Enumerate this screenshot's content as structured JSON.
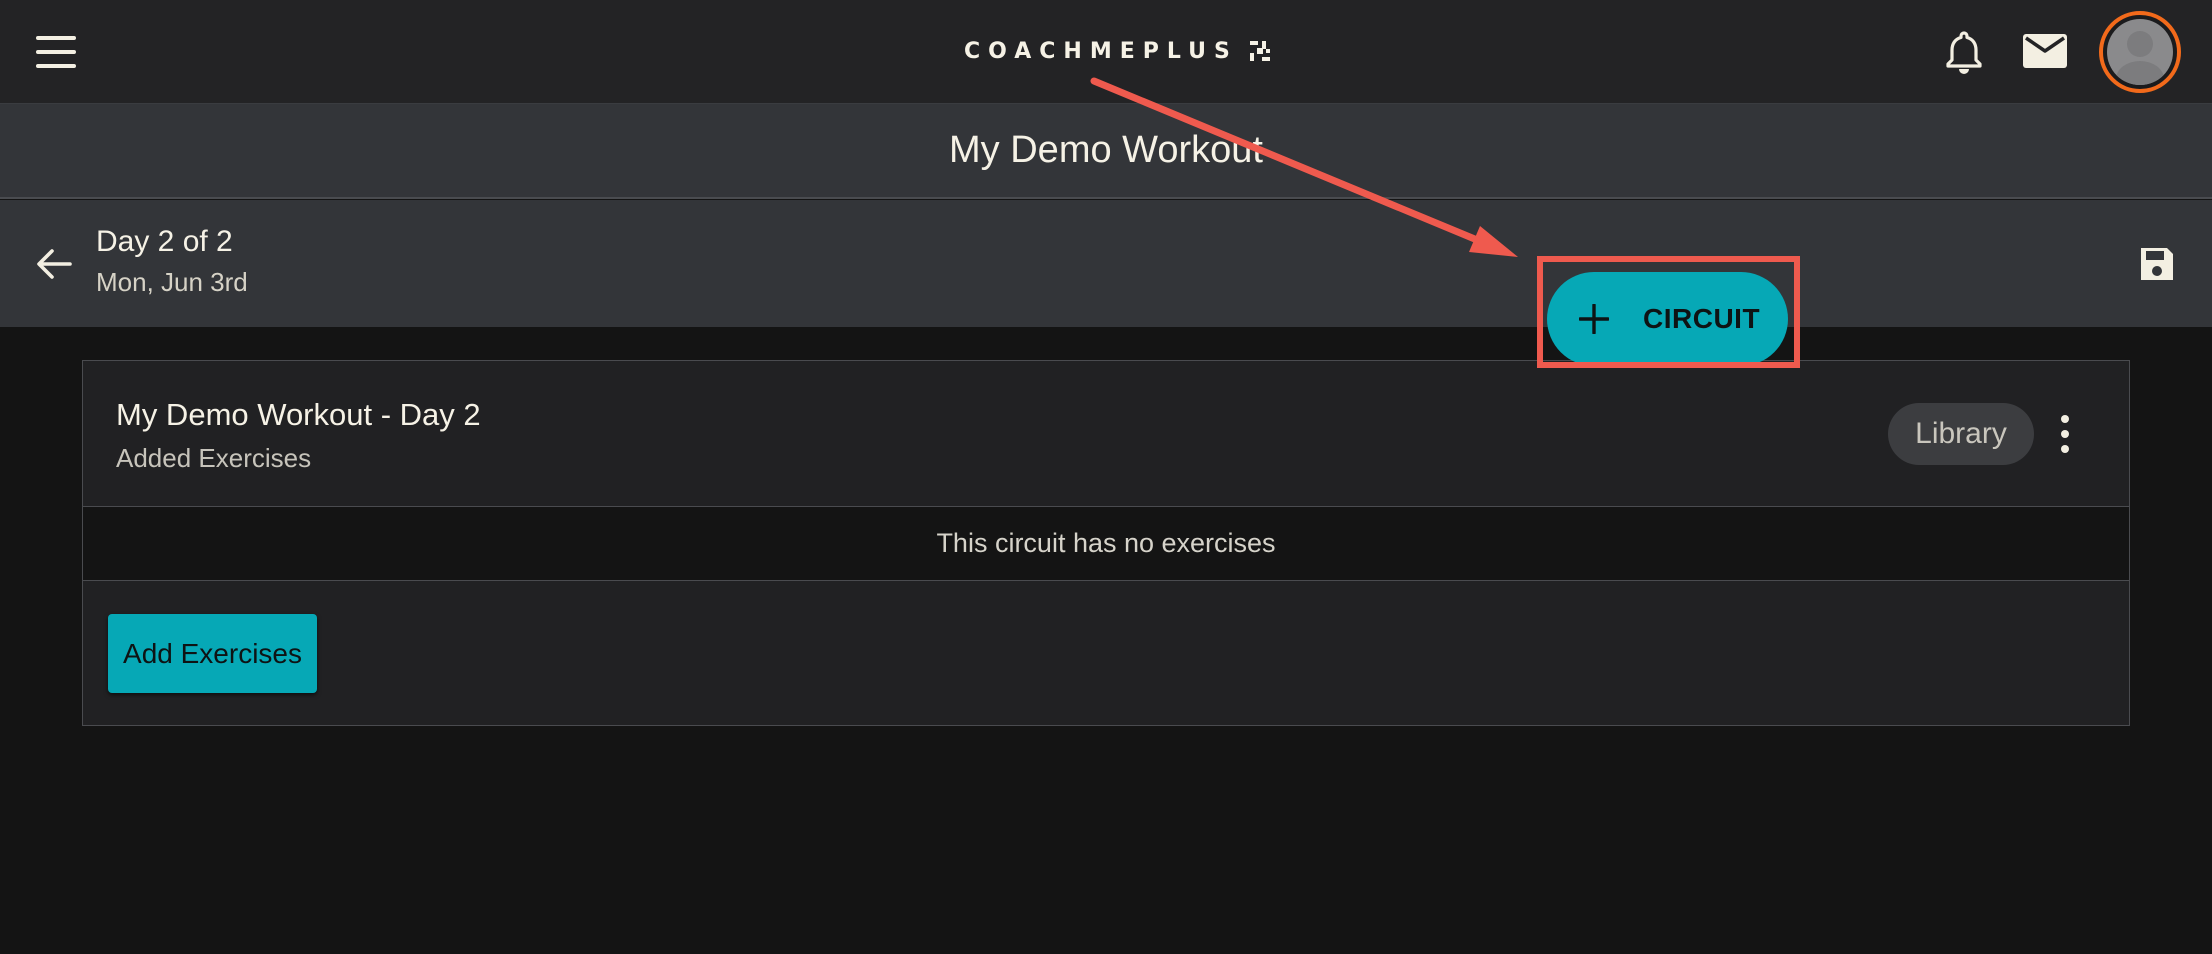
{
  "header": {
    "logo_text": "COACHMEPLUS",
    "icons": [
      "menu-icon",
      "bell-icon",
      "mail-icon",
      "avatar"
    ],
    "avatar_ring_color": "#f26a1b"
  },
  "workout": {
    "title": "My Demo Workout"
  },
  "day_nav": {
    "day_label": "Day 2 of 2",
    "date_label": "Mon, Jun 3rd"
  },
  "circuit_card": {
    "title": "My Demo Workout - Day 2",
    "subtitle": "Added Exercises",
    "library_label": "Library",
    "empty_message": "This circuit has no exercises",
    "add_exercises_label": "Add Exercises"
  },
  "fab": {
    "label": "CIRCUIT"
  },
  "colors": {
    "accent": "#06a8b6",
    "annotation": "#ef5a4e",
    "background": "#141414",
    "topbar": "#232325",
    "subbar": "#333539"
  }
}
